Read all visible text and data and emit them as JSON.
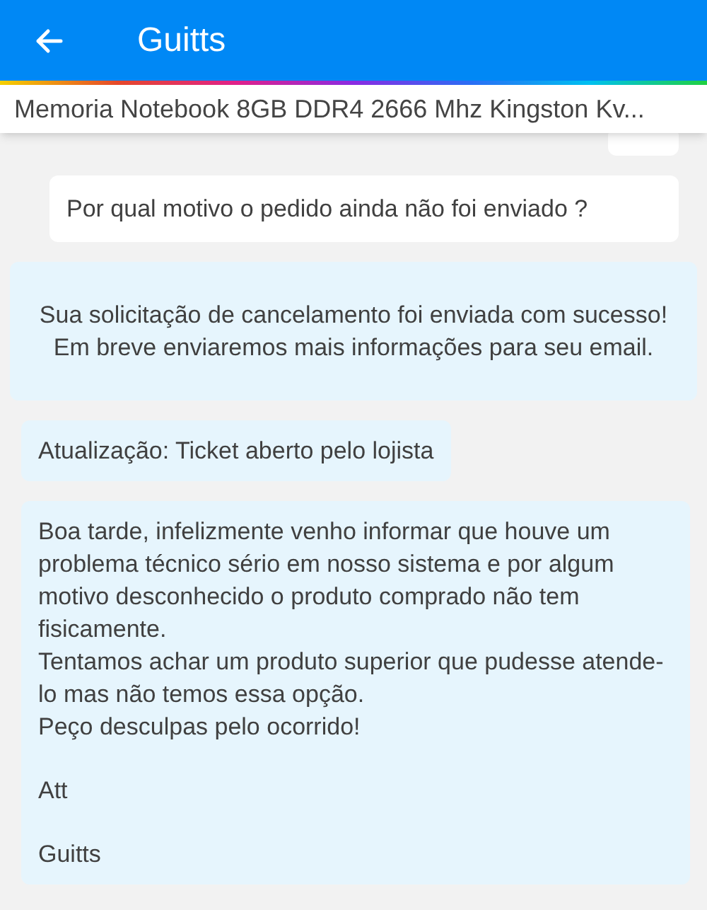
{
  "app_bar": {
    "title": "Guitts"
  },
  "product": {
    "title": "Memoria Notebook 8GB DDR4 2666 Mhz Kingston Kv..."
  },
  "messages": [
    {
      "kind": "sent",
      "blocks": [
        {
          "lines": [
            "Por qual motivo o pedido ainda não foi enviado ?"
          ]
        }
      ]
    },
    {
      "kind": "system",
      "blocks": [
        {
          "lines": [
            "Sua solicitação de cancelamento foi enviada com sucesso! Em breve enviaremos mais informações para seu email."
          ]
        }
      ]
    },
    {
      "kind": "received",
      "blocks": [
        {
          "lines": [
            "Atualização: Ticket aberto pelo lojista"
          ]
        }
      ]
    },
    {
      "kind": "received",
      "blocks": [
        {
          "lines": [
            "Boa tarde, infelizmente venho informar que houve um problema técnico sério em nosso sistema e por algum motivo desconhecido o produto comprado não tem fisicamente.",
            "Tentamos achar um produto superior que pudesse atende-lo mas não temos essa opção.",
            "Peço desculpas pelo ocorrido!"
          ]
        },
        {
          "lines": [
            "Att"
          ]
        },
        {
          "lines": [
            "Guitts"
          ]
        }
      ]
    }
  ]
}
